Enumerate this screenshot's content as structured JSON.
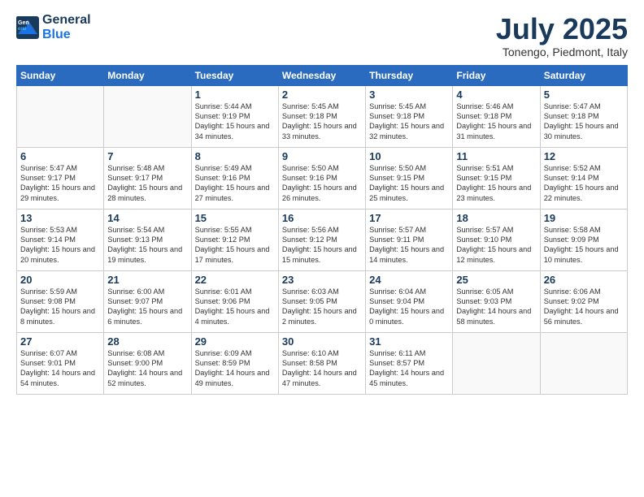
{
  "header": {
    "logo_line1": "General",
    "logo_line2": "Blue",
    "month_year": "July 2025",
    "location": "Tonengo, Piedmont, Italy"
  },
  "days_of_week": [
    "Sunday",
    "Monday",
    "Tuesday",
    "Wednesday",
    "Thursday",
    "Friday",
    "Saturday"
  ],
  "weeks": [
    [
      {
        "num": "",
        "info": ""
      },
      {
        "num": "",
        "info": ""
      },
      {
        "num": "1",
        "info": "Sunrise: 5:44 AM\nSunset: 9:19 PM\nDaylight: 15 hours\nand 34 minutes."
      },
      {
        "num": "2",
        "info": "Sunrise: 5:45 AM\nSunset: 9:18 PM\nDaylight: 15 hours\nand 33 minutes."
      },
      {
        "num": "3",
        "info": "Sunrise: 5:45 AM\nSunset: 9:18 PM\nDaylight: 15 hours\nand 32 minutes."
      },
      {
        "num": "4",
        "info": "Sunrise: 5:46 AM\nSunset: 9:18 PM\nDaylight: 15 hours\nand 31 minutes."
      },
      {
        "num": "5",
        "info": "Sunrise: 5:47 AM\nSunset: 9:18 PM\nDaylight: 15 hours\nand 30 minutes."
      }
    ],
    [
      {
        "num": "6",
        "info": "Sunrise: 5:47 AM\nSunset: 9:17 PM\nDaylight: 15 hours\nand 29 minutes."
      },
      {
        "num": "7",
        "info": "Sunrise: 5:48 AM\nSunset: 9:17 PM\nDaylight: 15 hours\nand 28 minutes."
      },
      {
        "num": "8",
        "info": "Sunrise: 5:49 AM\nSunset: 9:16 PM\nDaylight: 15 hours\nand 27 minutes."
      },
      {
        "num": "9",
        "info": "Sunrise: 5:50 AM\nSunset: 9:16 PM\nDaylight: 15 hours\nand 26 minutes."
      },
      {
        "num": "10",
        "info": "Sunrise: 5:50 AM\nSunset: 9:15 PM\nDaylight: 15 hours\nand 25 minutes."
      },
      {
        "num": "11",
        "info": "Sunrise: 5:51 AM\nSunset: 9:15 PM\nDaylight: 15 hours\nand 23 minutes."
      },
      {
        "num": "12",
        "info": "Sunrise: 5:52 AM\nSunset: 9:14 PM\nDaylight: 15 hours\nand 22 minutes."
      }
    ],
    [
      {
        "num": "13",
        "info": "Sunrise: 5:53 AM\nSunset: 9:14 PM\nDaylight: 15 hours\nand 20 minutes."
      },
      {
        "num": "14",
        "info": "Sunrise: 5:54 AM\nSunset: 9:13 PM\nDaylight: 15 hours\nand 19 minutes."
      },
      {
        "num": "15",
        "info": "Sunrise: 5:55 AM\nSunset: 9:12 PM\nDaylight: 15 hours\nand 17 minutes."
      },
      {
        "num": "16",
        "info": "Sunrise: 5:56 AM\nSunset: 9:12 PM\nDaylight: 15 hours\nand 15 minutes."
      },
      {
        "num": "17",
        "info": "Sunrise: 5:57 AM\nSunset: 9:11 PM\nDaylight: 15 hours\nand 14 minutes."
      },
      {
        "num": "18",
        "info": "Sunrise: 5:57 AM\nSunset: 9:10 PM\nDaylight: 15 hours\nand 12 minutes."
      },
      {
        "num": "19",
        "info": "Sunrise: 5:58 AM\nSunset: 9:09 PM\nDaylight: 15 hours\nand 10 minutes."
      }
    ],
    [
      {
        "num": "20",
        "info": "Sunrise: 5:59 AM\nSunset: 9:08 PM\nDaylight: 15 hours\nand 8 minutes."
      },
      {
        "num": "21",
        "info": "Sunrise: 6:00 AM\nSunset: 9:07 PM\nDaylight: 15 hours\nand 6 minutes."
      },
      {
        "num": "22",
        "info": "Sunrise: 6:01 AM\nSunset: 9:06 PM\nDaylight: 15 hours\nand 4 minutes."
      },
      {
        "num": "23",
        "info": "Sunrise: 6:03 AM\nSunset: 9:05 PM\nDaylight: 15 hours\nand 2 minutes."
      },
      {
        "num": "24",
        "info": "Sunrise: 6:04 AM\nSunset: 9:04 PM\nDaylight: 15 hours\nand 0 minutes."
      },
      {
        "num": "25",
        "info": "Sunrise: 6:05 AM\nSunset: 9:03 PM\nDaylight: 14 hours\nand 58 minutes."
      },
      {
        "num": "26",
        "info": "Sunrise: 6:06 AM\nSunset: 9:02 PM\nDaylight: 14 hours\nand 56 minutes."
      }
    ],
    [
      {
        "num": "27",
        "info": "Sunrise: 6:07 AM\nSunset: 9:01 PM\nDaylight: 14 hours\nand 54 minutes."
      },
      {
        "num": "28",
        "info": "Sunrise: 6:08 AM\nSunset: 9:00 PM\nDaylight: 14 hours\nand 52 minutes."
      },
      {
        "num": "29",
        "info": "Sunrise: 6:09 AM\nSunset: 8:59 PM\nDaylight: 14 hours\nand 49 minutes."
      },
      {
        "num": "30",
        "info": "Sunrise: 6:10 AM\nSunset: 8:58 PM\nDaylight: 14 hours\nand 47 minutes."
      },
      {
        "num": "31",
        "info": "Sunrise: 6:11 AM\nSunset: 8:57 PM\nDaylight: 14 hours\nand 45 minutes."
      },
      {
        "num": "",
        "info": ""
      },
      {
        "num": "",
        "info": ""
      }
    ]
  ]
}
